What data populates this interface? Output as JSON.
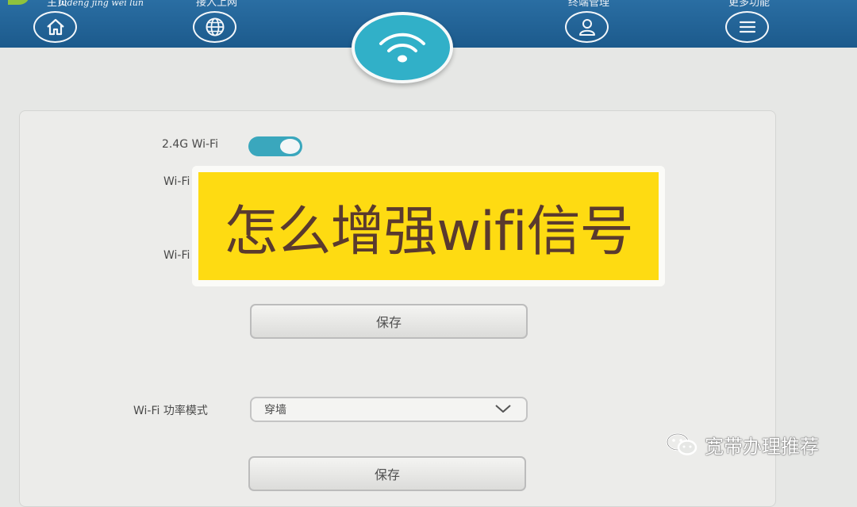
{
  "header": {
    "logo_text": "lüdeng jing wei lun",
    "nav": [
      {
        "label": "主页",
        "icon": "home-icon"
      },
      {
        "label": "接入上网",
        "icon": "globe-icon"
      },
      {
        "label": "终端管理",
        "icon": "user-icon"
      },
      {
        "label": "更多功能",
        "icon": "menu-icon"
      }
    ],
    "active_icon": "wifi-icon"
  },
  "form": {
    "wifi24_label": "2.4G Wi-Fi",
    "wifi24_enabled": true,
    "field2_label": "Wi-Fi",
    "field3_label": "Wi-Fi",
    "save_label_1": "保存",
    "power_mode_label": "Wi-Fi 功率模式",
    "power_mode_value": "穿墙",
    "save_label_2": "保存"
  },
  "overlay": {
    "title": "怎么增强wifi信号"
  },
  "watermark": {
    "text": "宽带办理推荐",
    "icon": "wechat-icon"
  },
  "colors": {
    "header": "#1f5f92",
    "accent": "#31b0c8",
    "banner": "#fedb12",
    "banner_text": "#5a3a2e"
  }
}
